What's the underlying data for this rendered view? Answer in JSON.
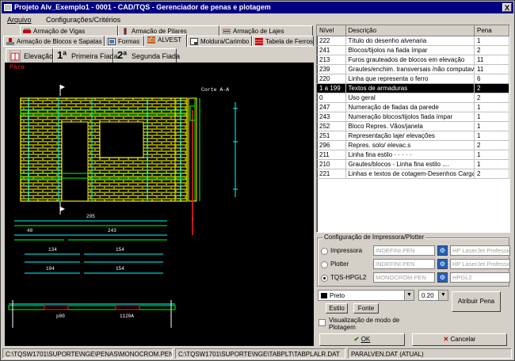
{
  "window": {
    "title": "Projeto Alv_Exemplo1 - 0001 - CAD/TQS - Gerenciador de penas e plotagem",
    "close_label": "X"
  },
  "menu": {
    "arquivo": "Arquivo",
    "config": "Configurações/Critérios"
  },
  "tabs_row1": [
    {
      "label": "Armação de Vigas",
      "icon": "beam-icon"
    },
    {
      "label": "Armação de Pilares",
      "icon": "column-icon"
    },
    {
      "label": "Armação de Lajes",
      "icon": "slab-icon"
    }
  ],
  "tabs_row2": [
    {
      "label": "Armação de Blocos e Sapatas",
      "icon": "footing-icon"
    },
    {
      "label": "Formas",
      "icon": "formwork-icon"
    },
    {
      "label": "ALVEST",
      "icon": "masonry-icon",
      "active": true
    },
    {
      "label": "Moldura/Carimbo",
      "icon": "frame-icon"
    },
    {
      "label": "Tabela de Ferros",
      "icon": "rebar-table-icon"
    }
  ],
  "subtabs": [
    {
      "label": "Elevação",
      "icon": "elevation-icon",
      "active": true
    },
    {
      "label": "Primeira Fiada",
      "prefix": "1ª"
    },
    {
      "label": "Segunda Fiada",
      "prefix": "2ª"
    }
  ],
  "drawing": {
    "wall_label": "Pare",
    "cut_label": "Corte A-A",
    "dim_295": "295",
    "dim_40": "40",
    "dim_243": "243",
    "dim_134": "134",
    "dim_154": "154",
    "dim_104": "104",
    "dim_p00": "p00",
    "dim_1120a": "1120A",
    "side_label": "Parede"
  },
  "pen_table": {
    "headers": [
      "Nível",
      "Descrição",
      "Pena"
    ],
    "rows": [
      [
        "222",
        "Título do desenho alvenaria",
        "1"
      ],
      [
        "241",
        "Blocos/tijolos na fiada ímpar",
        "2"
      ],
      [
        "213",
        "Furos grauteados de blocos em elevação",
        "11"
      ],
      [
        "239",
        "Grautes/enchim. transversais /não computave",
        "11"
      ],
      [
        "220",
        "Linha que representa o ferro",
        "6"
      ],
      [
        "1 a 199",
        "Textos de armaduras",
        "2"
      ],
      [
        "0",
        "Uso geral",
        "2"
      ],
      [
        "247",
        "Numeração de fiadas da parede",
        "1"
      ],
      [
        "243",
        "Numeração blocos/tijolos fiada ímpar",
        "1"
      ],
      [
        "252",
        "Bloco Repres. Vãos/janela",
        "1"
      ],
      [
        "251",
        "Representação laje/ elevações",
        "1"
      ],
      [
        "296",
        "Repres. solo/ elevac.s",
        "2"
      ],
      [
        "211",
        "Linha fina estilo · · · · ·",
        "1"
      ],
      [
        "210",
        "Grautes/blocos - Linha fina estilo ....",
        "1"
      ],
      [
        "221",
        "Linhas e textos de cotagem-Desenhos Cargas",
        "2"
      ]
    ],
    "selected_index": 5
  },
  "printer_config": {
    "legend": "Configuração de Impressora/Plotter",
    "rows": [
      {
        "label": "Impressora",
        "pen_file": "INDEFINI.PEN",
        "device": "HP LaserJet Professior",
        "selected": false
      },
      {
        "label": "Plotter",
        "pen_file": "INDEFINI.PEN",
        "device": "HP LaserJet Professior",
        "selected": false
      },
      {
        "label": "TQS-HPGL2",
        "pen_file": "MONOCROM.PEN",
        "device": "HPGL2",
        "selected": true
      }
    ]
  },
  "pen_controls": {
    "color": "Preto",
    "width": "0.20",
    "estilo_label": "Estilo",
    "fonte_label": "Fonte",
    "assign_label": "Atribuir Pena",
    "plot_mode_label": "Visualização de modo de Plotagem"
  },
  "actions": {
    "ok_label": "OK",
    "cancel_label": "Cancelar"
  },
  "status": {
    "pen_path": "C:\\TQSW1701\\SUPORTE\\NGE\\PENAS\\MONOCROM.PEN",
    "table_path": "C:\\TQSW1701\\SUPORTE\\NGE\\TABPLT\\TABPLALR.DAT",
    "paralven": "PARALVEN.DAT (ATUAL)"
  },
  "colors": {
    "titlebar": "#000080",
    "cad_background": "#000000",
    "wall_yellow": "#ffff00",
    "dimension_cyan": "#00ffff",
    "selected_row": "#000000"
  }
}
